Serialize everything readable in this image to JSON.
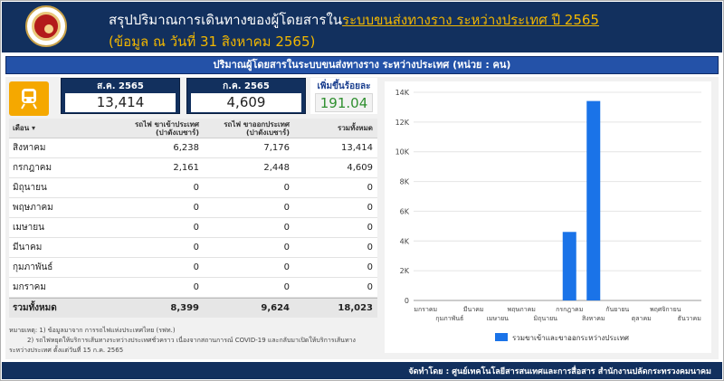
{
  "header": {
    "title_prefix": "สรุปปริมาณการเดินทางของผู้โดยสารใน",
    "title_highlight": "ระบบขนส่งทางราง ระหว่างประเทศ ปี 2565",
    "subtitle": "(ข้อมูล ณ วันที่ 31 สิงหาคม 2565)"
  },
  "banner": "ปริมาณผู้โดยสารในระบบขนส่งทางราง ระหว่างประเทศ (หน่วย : คน)",
  "kpis": {
    "current_label": "ส.ค. 2565",
    "current_value": "13,414",
    "previous_label": "ก.ค. 2565",
    "previous_value": "4,609",
    "increase_label": "เพิ่มขึ้นร้อยละ",
    "increase_value": "191.04"
  },
  "table": {
    "headers": [
      "เดือน ▾",
      "รถไฟ ขาเข้าประเทศ\n(ปาดังเบซาร์)",
      "รถไฟ ขาออกประเทศ\n(ปาดังเบซาร์)",
      "รวมทั้งหมด"
    ],
    "rows": [
      {
        "month": "สิงหาคม",
        "in": "6,238",
        "out": "7,176",
        "total": "13,414"
      },
      {
        "month": "กรกฎาคม",
        "in": "2,161",
        "out": "2,448",
        "total": "4,609"
      },
      {
        "month": "มิถุนายน",
        "in": "0",
        "out": "0",
        "total": "0"
      },
      {
        "month": "พฤษภาคม",
        "in": "0",
        "out": "0",
        "total": "0"
      },
      {
        "month": "เมษายน",
        "in": "0",
        "out": "0",
        "total": "0"
      },
      {
        "month": "มีนาคม",
        "in": "0",
        "out": "0",
        "total": "0"
      },
      {
        "month": "กุมภาพันธ์",
        "in": "0",
        "out": "0",
        "total": "0"
      },
      {
        "month": "มกราคม",
        "in": "0",
        "out": "0",
        "total": "0"
      }
    ],
    "footer": {
      "label": "รวมทั้งหมด",
      "in": "8,399",
      "out": "9,624",
      "total": "18,023"
    }
  },
  "notes": [
    "หมายเหตุ: 1) ข้อมูลมาจาก การรถไฟแห่งประเทศไทย (รฟท.)",
    "2) รถไฟหยุดให้บริการเส้นทางระหว่างประเทศชั่วคราว เนื่องจากสถานการณ์ COVID-19 และกลับมาเปิดให้บริการเส้นทาง",
    "ระหว่างประเทศ ตั้งแต่วันที่ 15 ก.ค. 2565"
  ],
  "chart_data": {
    "type": "bar",
    "categories": [
      "มกราคม",
      "กุมภาพันธ์",
      "มีนาคม",
      "เมษายน",
      "พฤษภาคม",
      "มิถุนายน",
      "กรกฎาคม",
      "สิงหาคม",
      "กันยายน",
      "ตุลาคม",
      "พฤศจิกายน",
      "ธันวาคม"
    ],
    "series": [
      {
        "name": "รวมขาเข้าและขาออกระหว่างประเทศ",
        "values": [
          0,
          0,
          0,
          0,
          0,
          0,
          4609,
          13414,
          0,
          0,
          0,
          0
        ]
      }
    ],
    "yticks": [
      "0",
      "2K",
      "4K",
      "6K",
      "8K",
      "10K",
      "12K",
      "14K"
    ],
    "ylim": [
      0,
      14000
    ],
    "grid": true,
    "legend_position": "bottom",
    "color": "#1a73e8"
  },
  "footer": "จัดทำโดย : ศูนย์เทคโนโลยีสารสนเทศและการสื่อสาร สำนักงานปลัดกระทรวงคมนาคม"
}
